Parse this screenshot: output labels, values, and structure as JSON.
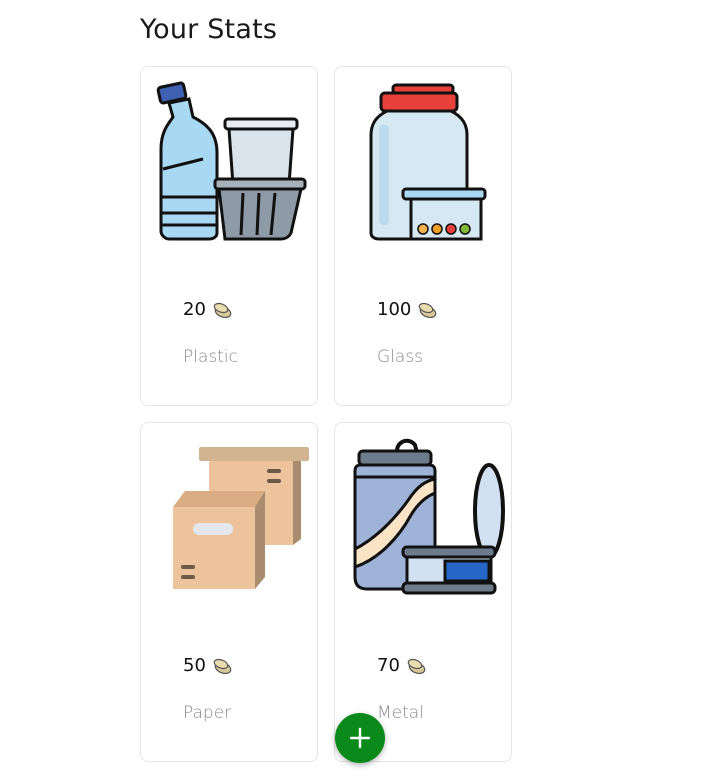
{
  "header": {
    "title": "Your Stats"
  },
  "cards": [
    {
      "count": "20",
      "label": "Plastic",
      "icon": "plastic-bottle-icon"
    },
    {
      "count": "100",
      "label": "Glass",
      "icon": "glass-jar-icon"
    },
    {
      "count": "50",
      "label": "Paper",
      "icon": "cardboard-box-icon"
    },
    {
      "count": "70",
      "label": "Metal",
      "icon": "metal-can-icon"
    }
  ],
  "fab": {
    "icon": "plus-icon"
  },
  "colors": {
    "fab": "#0a8a1a",
    "jar_lid": "#e8403a",
    "bottle_cap": "#3f5fb0"
  }
}
